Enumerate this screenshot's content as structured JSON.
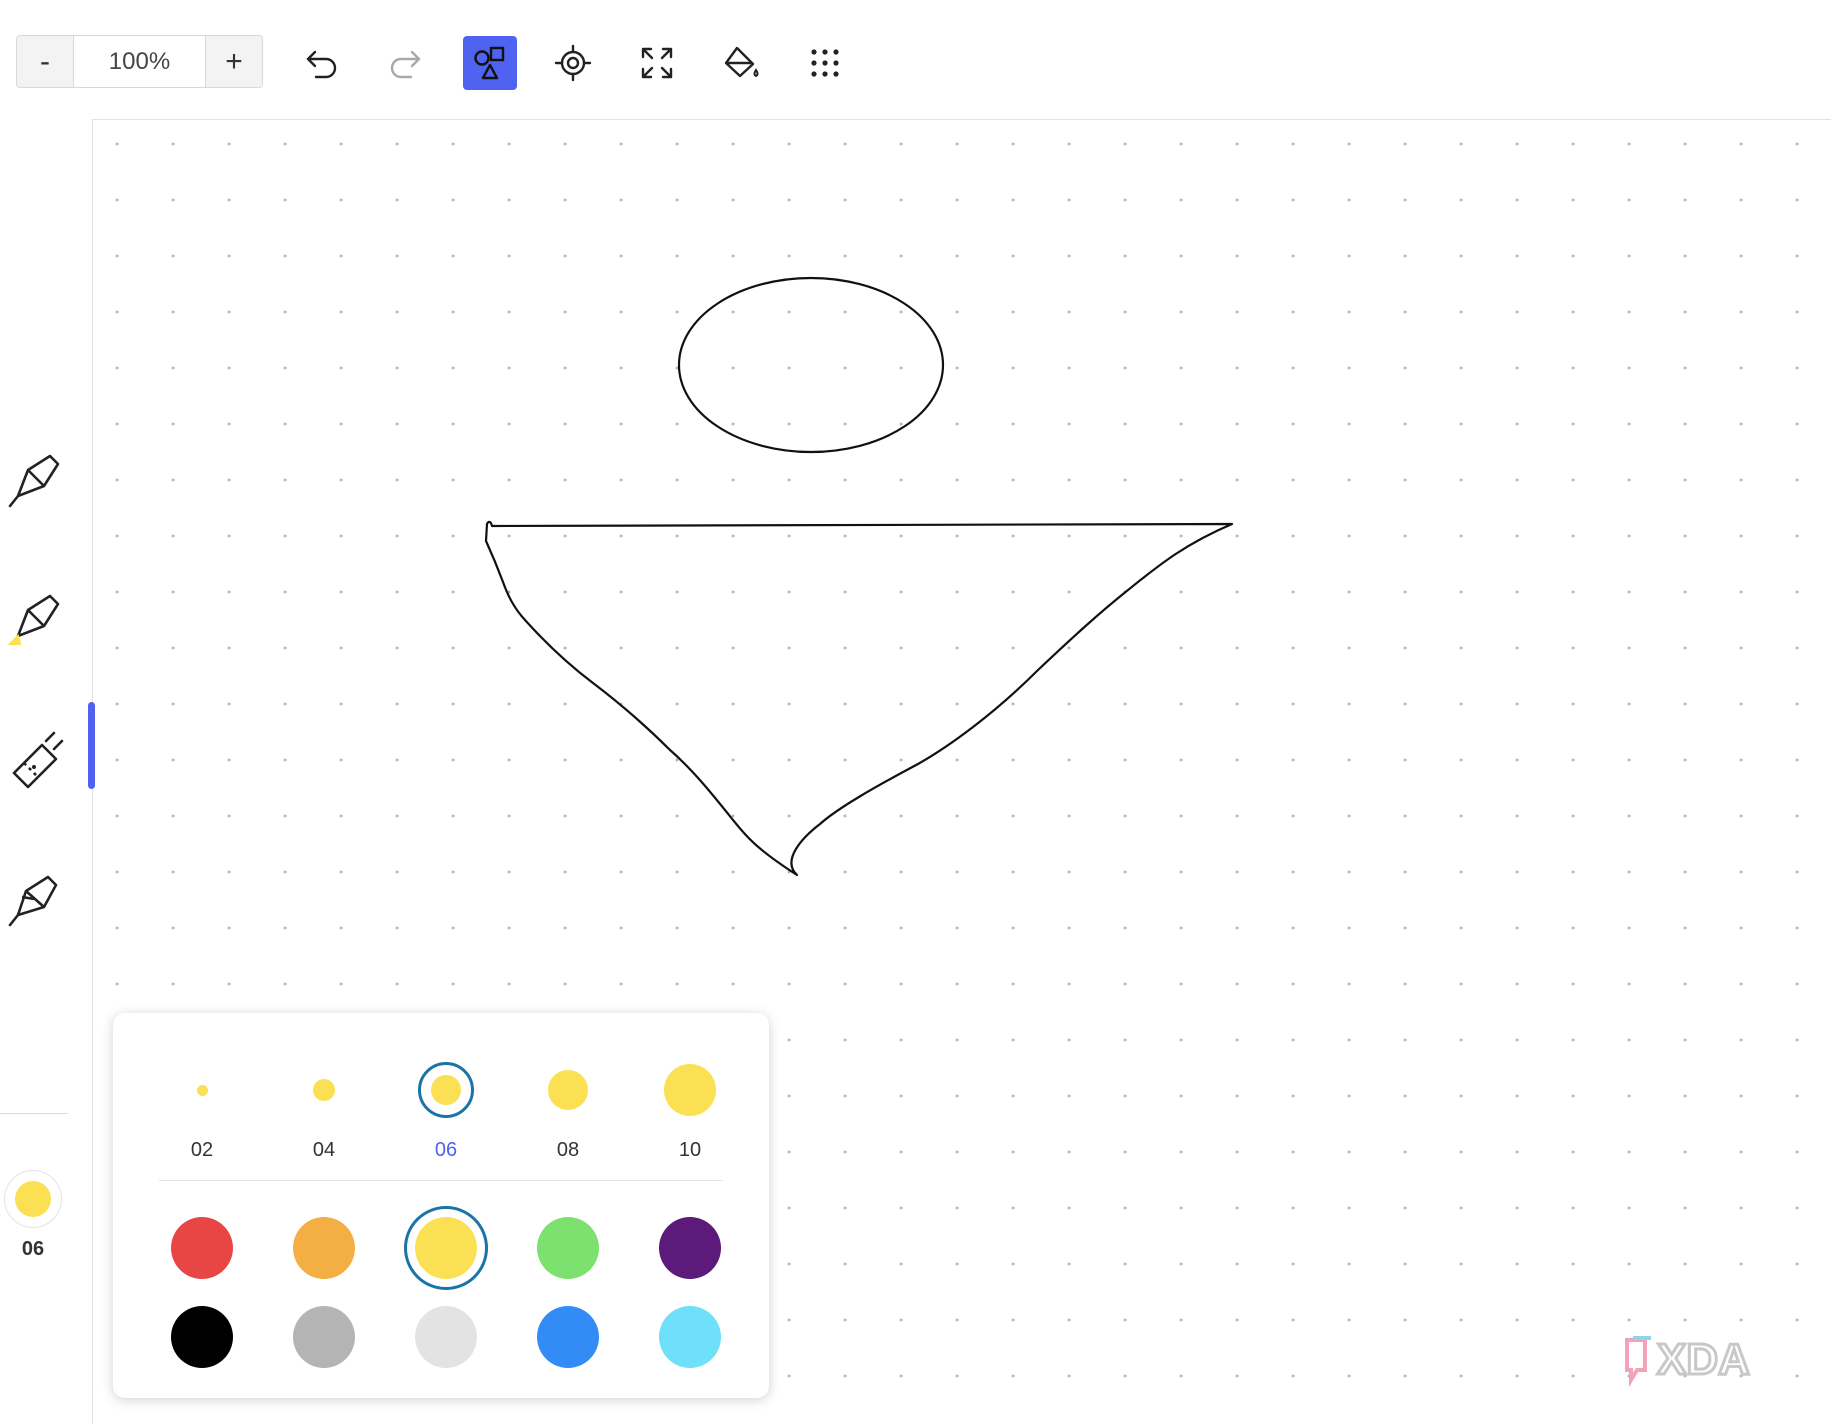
{
  "toolbar": {
    "zoom_out_label": "-",
    "zoom_value": "100%",
    "zoom_in_label": "+",
    "tools": [
      "undo-icon",
      "redo-icon",
      "shapes-icon",
      "locate-icon",
      "fit-to-screen-icon",
      "fill-bucket-icon",
      "more-grid-icon"
    ],
    "active_tool": "shapes-icon",
    "accent_color": "#4f63f0"
  },
  "rail": {
    "pens": [
      "pen-icon",
      "highlighter-icon",
      "eraser-icon",
      "calligraphy-pen-icon"
    ],
    "active_pen": "highlighter-icon",
    "current_color": "#fae052",
    "current_size": "06"
  },
  "palette": {
    "sizes": [
      {
        "label": "02",
        "selected": false
      },
      {
        "label": "04",
        "selected": false
      },
      {
        "label": "06",
        "selected": true
      },
      {
        "label": "08",
        "selected": false
      },
      {
        "label": "10",
        "selected": false
      }
    ],
    "colors": [
      {
        "name": "red",
        "hex": "#e84545"
      },
      {
        "name": "orange",
        "hex": "#f3ae44"
      },
      {
        "name": "yellow",
        "hex": "#fae052",
        "selected": true
      },
      {
        "name": "green",
        "hex": "#7de16f"
      },
      {
        "name": "purple",
        "hex": "#5c1b7a"
      },
      {
        "name": "black",
        "hex": "#000000"
      },
      {
        "name": "gray",
        "hex": "#b4b4b4"
      },
      {
        "name": "light-gray",
        "hex": "#e3e3e3"
      },
      {
        "name": "blue",
        "hex": "#338cf5"
      },
      {
        "name": "cyan",
        "hex": "#6ee0fa"
      }
    ]
  },
  "canvas": {
    "shapes": [
      "ellipse",
      "triangle"
    ],
    "stroke_color": "#111111"
  },
  "watermark": "XDA"
}
